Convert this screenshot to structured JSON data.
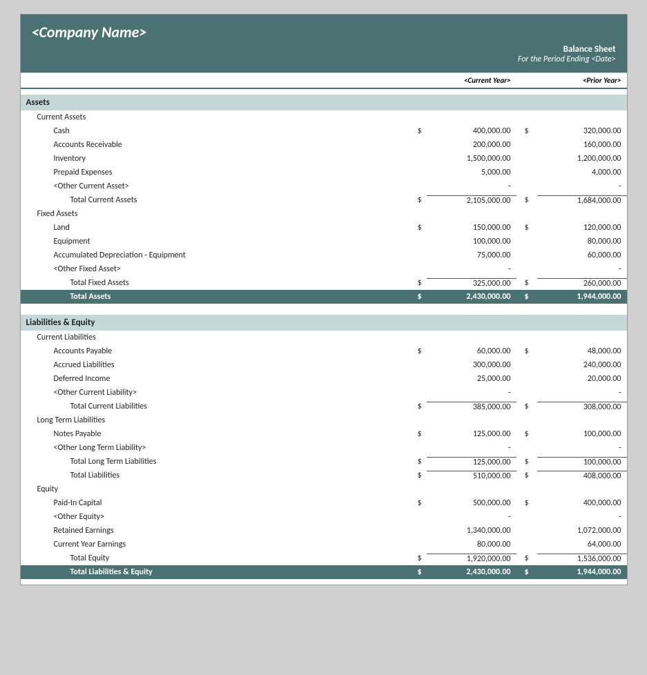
{
  "header": {
    "company_name": "<Company Name>",
    "report_title": "Balance Sheet",
    "report_subtitle": "For the Period Ending <Date>",
    "col_current": "<Current Year>",
    "col_prior": "<Prior Year>"
  },
  "sections": [
    {
      "id": "assets",
      "title": "Assets",
      "subsections": [
        {
          "id": "current_assets",
          "title": "Current Assets",
          "rows": [
            {
              "label": "Cash",
              "show_dollar": true,
              "current": "400,000.00",
              "prior": "320,000.00",
              "prior_dollar": true
            },
            {
              "label": "Accounts Receivable",
              "show_dollar": false,
              "current": "200,000.00",
              "prior": "160,000.00"
            },
            {
              "label": "Inventory",
              "show_dollar": false,
              "current": "1,500,000.00",
              "prior": "1,200,000.00"
            },
            {
              "label": "Prepaid Expenses",
              "show_dollar": false,
              "current": "5,000.00",
              "prior": "4,000.00"
            },
            {
              "label": "<Other Current Asset>",
              "show_dollar": false,
              "current": "-",
              "prior": "-"
            }
          ],
          "total": {
            "label": "Total Current Assets",
            "show_dollar": true,
            "current": "2,105,000.00",
            "prior": "1,684,000.00",
            "prior_dollar": true
          }
        },
        {
          "id": "fixed_assets",
          "title": "Fixed Assets",
          "rows": [
            {
              "label": "Land",
              "show_dollar": true,
              "current": "150,000.00",
              "prior": "120,000.00",
              "prior_dollar": true
            },
            {
              "label": "Equipment",
              "show_dollar": false,
              "current": "100,000.00",
              "prior": "80,000.00"
            },
            {
              "label": "Accumulated Depreciation - Equipment",
              "show_dollar": false,
              "current": "75,000.00",
              "prior": "60,000.00"
            },
            {
              "label": "<Other Fixed Asset>",
              "show_dollar": false,
              "current": "-",
              "prior": "-"
            }
          ],
          "total": {
            "label": "Total Fixed Assets",
            "show_dollar": true,
            "current": "325,000.00",
            "prior": "260,000.00",
            "prior_dollar": true
          }
        }
      ],
      "grand_total": {
        "label": "Total Assets",
        "current": "2,430,000.00",
        "prior": "1,944,000.00"
      }
    },
    {
      "id": "liabilities_equity",
      "title": "Liabilities & Equity",
      "subsections": [
        {
          "id": "current_liabilities",
          "title": "Current Liabilities",
          "rows": [
            {
              "label": "Accounts Payable",
              "show_dollar": true,
              "current": "60,000.00",
              "prior": "48,000.00",
              "prior_dollar": true
            },
            {
              "label": "Accrued Liabilities",
              "show_dollar": false,
              "current": "300,000.00",
              "prior": "240,000.00"
            },
            {
              "label": "Deferred Income",
              "show_dollar": false,
              "current": "25,000.00",
              "prior": "20,000.00"
            },
            {
              "label": "<Other Current Liability>",
              "show_dollar": false,
              "current": "-",
              "prior": "-"
            }
          ],
          "total": {
            "label": "Total Current Liabilities",
            "show_dollar": true,
            "current": "385,000.00",
            "prior": "308,000.00",
            "prior_dollar": true
          }
        },
        {
          "id": "long_term_liabilities",
          "title": "Long Term Liabilities",
          "rows": [
            {
              "label": "Notes Payable",
              "show_dollar": true,
              "current": "125,000.00",
              "prior": "100,000.00",
              "prior_dollar": true
            },
            {
              "label": "<Other Long Term Liability>",
              "show_dollar": false,
              "current": "-",
              "prior": "-"
            }
          ],
          "total": {
            "label": "Total Long Term Liabilities",
            "show_dollar": true,
            "current": "125,000.00",
            "prior": "100,000.00",
            "prior_dollar": true
          }
        },
        {
          "id": "total_liabilities",
          "is_summary": true,
          "total": {
            "label": "Total Liabilities",
            "show_dollar": true,
            "current": "510,000.00",
            "prior": "408,000.00",
            "prior_dollar": true
          }
        },
        {
          "id": "equity",
          "title": "Equity",
          "rows": [
            {
              "label": "Paid-In Capital",
              "show_dollar": true,
              "current": "500,000.00",
              "prior": "400,000.00",
              "prior_dollar": true
            },
            {
              "label": "<Other Equity>",
              "show_dollar": false,
              "current": "-",
              "prior": "-"
            },
            {
              "label": "Retained Earnings",
              "show_dollar": false,
              "current": "1,340,000.00",
              "prior": "1,072,000.00"
            },
            {
              "label": "Current Year Earnings",
              "show_dollar": false,
              "current": "80,000.00",
              "prior": "64,000.00"
            }
          ],
          "total": {
            "label": "Total Equity",
            "show_dollar": true,
            "current": "1,920,000.00",
            "prior": "1,536,000.00",
            "prior_dollar": true
          }
        }
      ],
      "grand_total": {
        "label": "Total Liabilities & Equity",
        "current": "2,430,000.00",
        "prior": "1,944,000.00"
      }
    }
  ]
}
